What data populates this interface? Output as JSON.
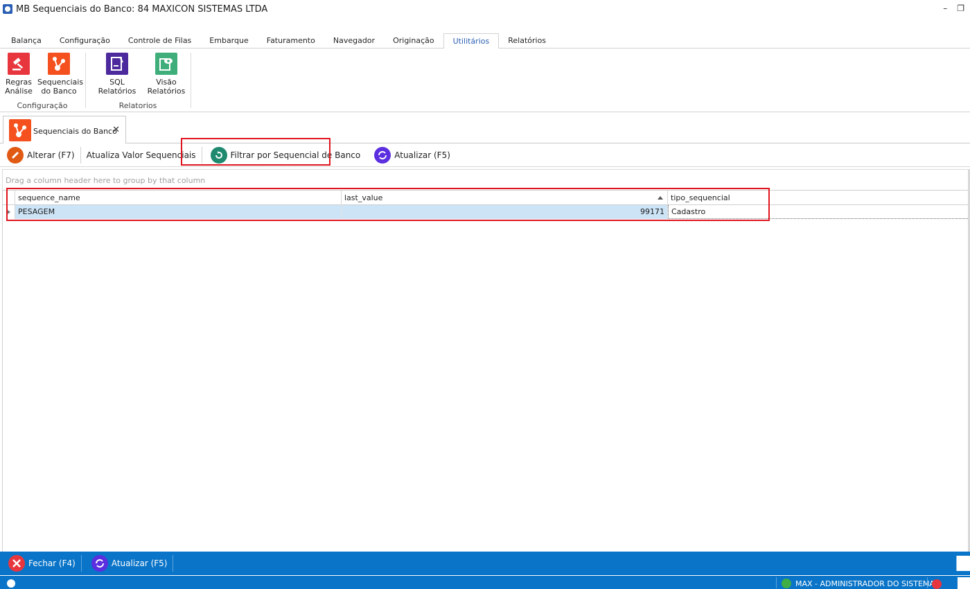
{
  "window": {
    "title": "MB Sequenciais do Banco: 84 MAXICON SISTEMAS LTDA",
    "minimize_glyph": "–",
    "restore_glyph": "❐"
  },
  "ribbon": {
    "tabs": [
      {
        "label": "Balança"
      },
      {
        "label": "Configuração"
      },
      {
        "label": "Controle de Filas"
      },
      {
        "label": "Embarque"
      },
      {
        "label": "Faturamento"
      },
      {
        "label": "Navegador"
      },
      {
        "label": "Originação"
      },
      {
        "label": "Utilitários",
        "active": true
      },
      {
        "label": "Relatórios"
      }
    ],
    "groups": [
      {
        "label": "Configuração",
        "buttons": [
          {
            "label_line1": "Regras",
            "label_line2": "Análise",
            "icon": "gavel-icon",
            "color": "#e8363e"
          },
          {
            "label_line1": "Sequenciais",
            "label_line2": "do Banco",
            "icon": "share-nodes-icon",
            "color": "#f4511e"
          }
        ]
      },
      {
        "label": "Relatorios",
        "buttons": [
          {
            "label_line1": "SQL Relatórios",
            "label_line2": "",
            "icon": "report-pen-icon",
            "color": "#4c2a9e"
          },
          {
            "label_line1": "Visão",
            "label_line2": "Relatórios",
            "icon": "report-eye-icon",
            "color": "#3fae7a"
          }
        ]
      }
    ]
  },
  "document_tab": {
    "label": "Sequenciais do Banco",
    "icon": "share-nodes-icon",
    "close_glyph": "✕"
  },
  "toolbar": {
    "alterar": "Alterar (F7)",
    "atualiza_valor": "Atualiza Valor Sequenciais",
    "filtrar": "Filtrar por Sequencial de Banco",
    "atualizar": "Atualizar (F5)"
  },
  "grid": {
    "group_panel_hint": "Drag a column header here to group by that column",
    "columns": [
      "sequence_name",
      "last_value",
      "tipo_sequencial"
    ],
    "sorted_column": "last_value",
    "rows": [
      {
        "sequence_name": "PESAGEM",
        "last_value": "99171",
        "tipo_sequencial": "Cadastro"
      }
    ]
  },
  "footer": {
    "fechar": "Fechar (F4)",
    "atualizar": "Atualizar (F5)"
  },
  "status": {
    "user": "MAX - ADMINISTRADOR DO SISTEMA"
  },
  "colors": {
    "accent_blue": "#0a74c8",
    "highlight_red": "#e0141e",
    "selected_row": "#cde4f7"
  }
}
